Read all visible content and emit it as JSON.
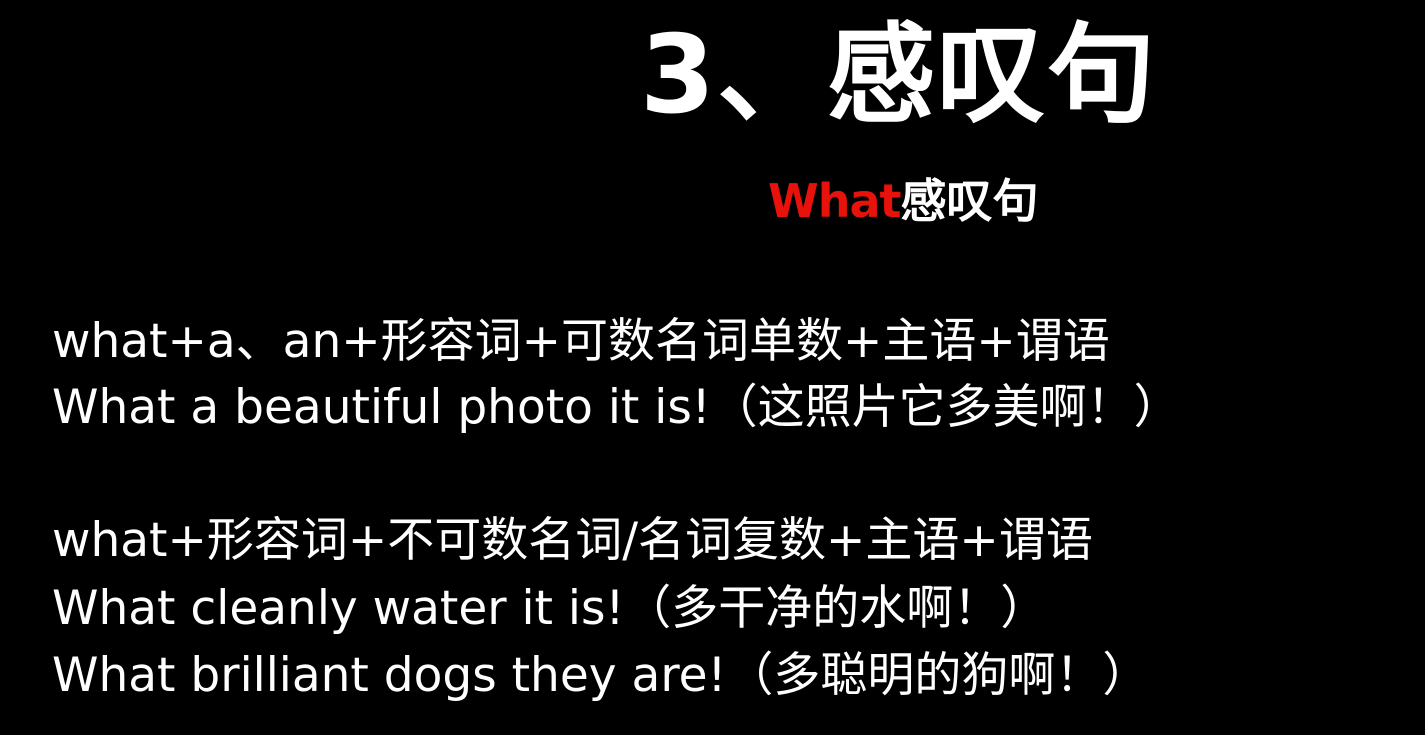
{
  "title": "3、感叹句",
  "subtitle": {
    "highlight": "What",
    "rest": "感叹句",
    "highlight_color": "#e8120c"
  },
  "lines": [
    "what+a、an+形容词+可数名词单数+主语+谓语",
    "What a beautiful photo it is!（这照片它多美啊！）",
    "what+形容词+不可数名词/名词复数+主语+谓语",
    "What cleanly water it is!（多干净的水啊！）",
    "What brilliant dogs they are!（多聪明的狗啊！）"
  ]
}
